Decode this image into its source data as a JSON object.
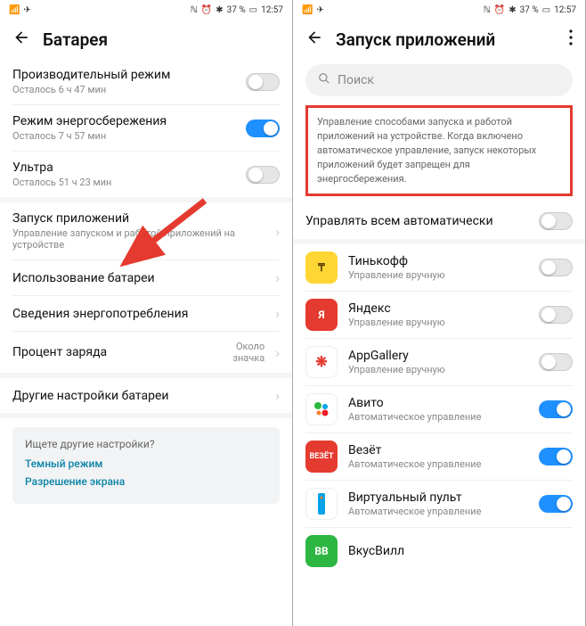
{
  "status": {
    "battery": "37 %",
    "time": "12:57"
  },
  "left": {
    "title": "Батарея",
    "rows": {
      "perf": {
        "label": "Производительный режим",
        "sub": "Осталось 6 ч 47 мин"
      },
      "save": {
        "label": "Режим энергосбережения",
        "sub": "Осталось 7 ч 57 мин"
      },
      "ultra": {
        "label": "Ультра",
        "sub": "Осталось 51 ч 23 мин"
      },
      "launch": {
        "label": "Запуск приложений",
        "sub": "Управление запуском и работой приложений на устройстве"
      },
      "usage": {
        "label": "Использование батареи"
      },
      "stats": {
        "label": "Сведения энергопотребления"
      },
      "pct": {
        "label": "Процент заряда",
        "note": "Около\nзначка"
      },
      "other": {
        "label": "Другие настройки батареи"
      }
    },
    "hint": {
      "q": "Ищете другие настройки?",
      "link1": "Темный режим",
      "link2": "Разрешение экрана"
    }
  },
  "right": {
    "title": "Запуск приложений",
    "search_placeholder": "Поиск",
    "info": "Управление способами запуска и работой приложений на устройстве. Когда включено автоматическое управление, запуск некоторых приложений будет запрещен для энергосбережения.",
    "manage_all": "Управлять всем автоматически",
    "mgmt_manual": "Управление вручную",
    "mgmt_auto": "Автоматическое управление",
    "apps": {
      "tinkoff": {
        "name": "Тинькофф"
      },
      "yandex": {
        "name": "Яндекс"
      },
      "appgal": {
        "name": "AppGallery"
      },
      "avito": {
        "name": "Авито"
      },
      "vezet": {
        "name": "Везёт"
      },
      "virtpult": {
        "name": "Виртуальный пульт"
      },
      "vkusvill": {
        "name": "ВкусВилл"
      }
    }
  }
}
